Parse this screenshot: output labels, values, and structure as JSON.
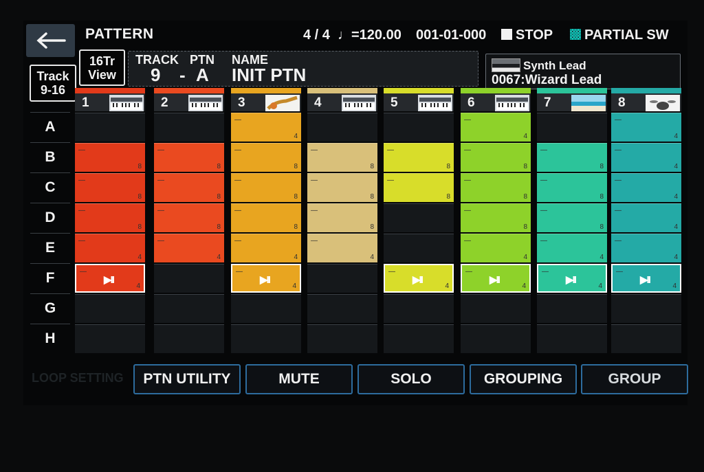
{
  "header": {
    "title": "PATTERN",
    "time_signature": "4 / 4",
    "tempo": "♩=120.00",
    "position": "001-01-000",
    "transport": "STOP",
    "partial_sw": "PARTIAL SW"
  },
  "view_button": {
    "line1": "16Tr",
    "line2": "View"
  },
  "track_group_button": {
    "line1": "Track",
    "line2": "9-16"
  },
  "track_info": {
    "track_label": "TRACK",
    "ptn_label": "PTN",
    "name_label": "NAME",
    "track_value": "9",
    "separator": "-",
    "ptn_value": "A",
    "name_value": "INIT PTN"
  },
  "tone": {
    "type": "Synth Lead",
    "name": "0067:Wizard Lead"
  },
  "rows": [
    "A",
    "B",
    "C",
    "D",
    "E",
    "F",
    "G",
    "H"
  ],
  "tracks": [
    {
      "number": "1",
      "color": "#e23a1a",
      "thumb": "keyboard-icon",
      "cells": [
        "",
        "8",
        "8",
        "8",
        "4",
        "play"
      ]
    },
    {
      "number": "2",
      "color": "#ea4a20",
      "thumb": "keyboard-icon",
      "cells": [
        "",
        "8",
        "8",
        "8",
        "4",
        ""
      ]
    },
    {
      "number": "3",
      "color": "#e8a520",
      "thumb": "guitar-icon",
      "cells": [
        "4",
        "8",
        "8",
        "8",
        "4",
        "play"
      ]
    },
    {
      "number": "4",
      "color": "#d9c07a",
      "thumb": "keyboard-icon",
      "cells": [
        "",
        "8",
        "8",
        "8",
        "4",
        ""
      ]
    },
    {
      "number": "5",
      "color": "#d8dd2a",
      "thumb": "keyboard-icon",
      "cells": [
        "",
        "8",
        "8",
        "",
        "",
        "play"
      ]
    },
    {
      "number": "6",
      "color": "#8ed22a",
      "thumb": "keyboard-icon",
      "cells": [
        "4",
        "8",
        "8",
        "8",
        "4",
        "play"
      ]
    },
    {
      "number": "7",
      "color": "#2cc49a",
      "thumb": "beach-icon",
      "cells": [
        "",
        "8",
        "8",
        "8",
        "4",
        "play"
      ]
    },
    {
      "number": "8",
      "color": "#24aaa6",
      "thumb": "drums-icon",
      "cells": [
        "4",
        "4",
        "4",
        "4",
        "4",
        "play"
      ]
    }
  ],
  "cell_marker": "—",
  "play_label": "▶II",
  "function_ghost": "LOOP SETTING",
  "function_buttons": [
    "PTN UTILITY",
    "MUTE",
    "SOLO",
    "GROUPING",
    "GROUP"
  ]
}
